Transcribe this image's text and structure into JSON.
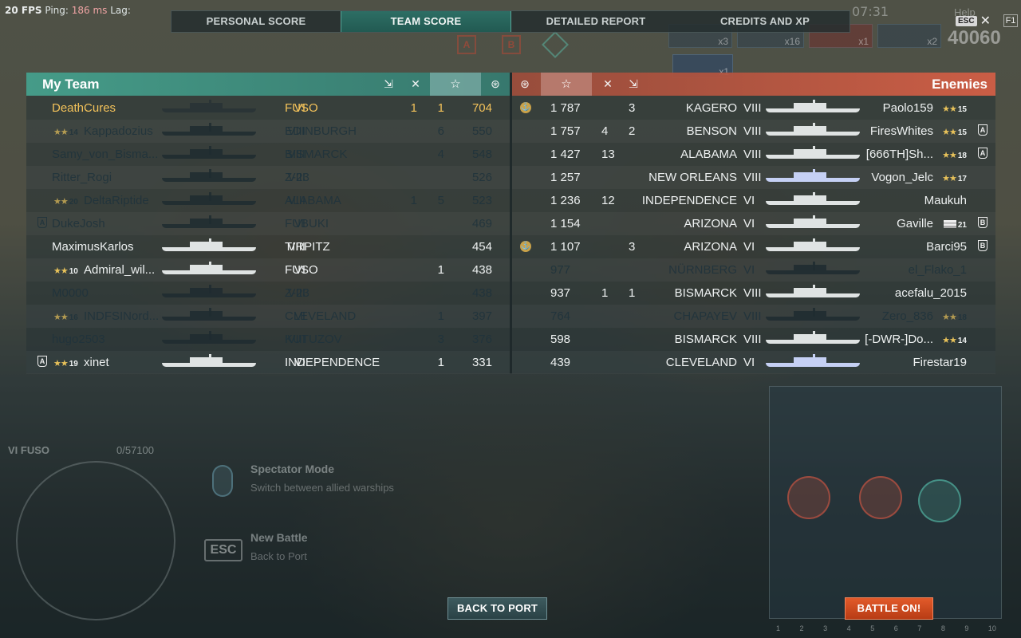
{
  "hud": {
    "fps": "20 FPS",
    "ping_label": "Ping:",
    "ping_value": "186 ms",
    "lag_label": "Lag:",
    "clock": "07:31",
    "help": "Help",
    "f1": "F1",
    "esc": "ESC",
    "team_score_total": "40060",
    "kill_feed": [
      "x3",
      "x16",
      "x1",
      "x2",
      "x1"
    ]
  },
  "tabs": [
    {
      "label": "PERSONAL SCORE",
      "active": false
    },
    {
      "label": "TEAM SCORE",
      "active": true
    },
    {
      "label": "DETAILED REPORT",
      "active": false
    },
    {
      "label": "CREDITS AND XP",
      "active": false
    }
  ],
  "caps": [
    "A",
    "B",
    "C"
  ],
  "my_team": {
    "title": "My Team",
    "players": [
      {
        "name": "DeathCures",
        "tier": "VI",
        "ship": "FUSO",
        "c1": "1",
        "c2": "1",
        "score": "704",
        "state": "me",
        "rank": ""
      },
      {
        "name": "Kappadozius",
        "tier": "VIII",
        "ship": "EDINBURGH",
        "c1": "",
        "c2": "6",
        "score": "550",
        "state": "dead",
        "rank": "14"
      },
      {
        "name": "Samy_von_Bisma...",
        "tier": "VIII",
        "ship": "BISMARCK",
        "c1": "",
        "c2": "4",
        "score": "548",
        "state": "dead",
        "rank": ""
      },
      {
        "name": "Ritter_Rogi",
        "tier": "VIII",
        "ship": "Z-23",
        "c1": "",
        "c2": "",
        "score": "526",
        "state": "dead",
        "rank": ""
      },
      {
        "name": "DeltaRiptide",
        "tier": "VIII",
        "ship": "ALABAMA",
        "c1": "1",
        "c2": "5",
        "score": "523",
        "state": "dead",
        "rank": "20"
      },
      {
        "name": "DukeJosh",
        "tier": "VI",
        "ship": "FUBUKI",
        "c1": "",
        "c2": "",
        "score": "469",
        "state": "dead",
        "rank": "",
        "division": "A"
      },
      {
        "name": "MaximusKarlos",
        "tier": "VIII",
        "ship": "TIRPITZ",
        "c1": "",
        "c2": "",
        "score": "454",
        "state": "alive",
        "rank": ""
      },
      {
        "name": "Admiral_wil...",
        "tier": "VI",
        "ship": "FUSO",
        "c1": "",
        "c2": "1",
        "score": "438",
        "state": "alive",
        "rank": "10"
      },
      {
        "name": "M0000",
        "tier": "VIII",
        "ship": "Z-23",
        "c1": "",
        "c2": "",
        "score": "438",
        "state": "dead",
        "rank": ""
      },
      {
        "name": "INDFSINord...",
        "tier": "VI",
        "ship": "CLEVELAND",
        "c1": "",
        "c2": "1",
        "score": "397",
        "state": "dead",
        "rank": "16"
      },
      {
        "name": "hugo2503",
        "tier": "VIII",
        "ship": "KUTUZOV",
        "c1": "",
        "c2": "3",
        "score": "376",
        "state": "dead",
        "rank": ""
      },
      {
        "name": "xinet",
        "tier": "VI",
        "ship": "INDEPENDENCE",
        "c1": "",
        "c2": "1",
        "score": "331",
        "state": "alive",
        "rank": "19",
        "division": "A"
      }
    ]
  },
  "enemies": {
    "title": "Enemies",
    "players": [
      {
        "name": "Paolo159",
        "tier": "VIII",
        "ship": "KAGERO",
        "c1": "",
        "c2": "3",
        "score": "1 787",
        "state": "alive",
        "rank": "15",
        "medal": true
      },
      {
        "name": "FiresWhites",
        "tier": "VIII",
        "ship": "BENSON",
        "c1": "4",
        "c2": "2",
        "score": "1 757",
        "state": "alive",
        "rank": "15",
        "division": "A"
      },
      {
        "name": "[666TH]Sh...",
        "tier": "VIII",
        "ship": "ALABAMA",
        "c1": "13",
        "c2": "",
        "score": "1 427",
        "state": "alive",
        "rank": "18",
        "division": "A"
      },
      {
        "name": "Vogon_Jelc",
        "tier": "VIII",
        "ship": "NEW ORLEANS",
        "c1": "",
        "c2": "",
        "score": "1 257",
        "state": "alive",
        "rank": "17",
        "blue": true
      },
      {
        "name": "Maukuh",
        "tier": "VI",
        "ship": "INDEPENDENCE",
        "c1": "12",
        "c2": "",
        "score": "1 236",
        "state": "alive",
        "rank": ""
      },
      {
        "name": "Gaville",
        "tier": "VI",
        "ship": "ARIZONA",
        "c1": "",
        "c2": "",
        "score": "1 154",
        "state": "alive",
        "rank": "21",
        "division": "B",
        "flag": true
      },
      {
        "name": "Barci95",
        "tier": "VI",
        "ship": "ARIZONA",
        "c1": "",
        "c2": "3",
        "score": "1 107",
        "state": "alive",
        "rank": "",
        "division": "B",
        "medal": true
      },
      {
        "name": "el_Flako_1",
        "tier": "VI",
        "ship": "NÜRNBERG",
        "c1": "",
        "c2": "",
        "score": "977",
        "state": "dead",
        "rank": ""
      },
      {
        "name": "acefalu_2015",
        "tier": "VIII",
        "ship": "BISMARCK",
        "c1": "1",
        "c2": "1",
        "score": "937",
        "state": "alive",
        "rank": ""
      },
      {
        "name": "Zero_836",
        "tier": "VIII",
        "ship": "CHAPAYEV",
        "c1": "",
        "c2": "",
        "score": "764",
        "state": "dead",
        "rank": "18"
      },
      {
        "name": "[-DWR-]Do...",
        "tier": "VIII",
        "ship": "BISMARCK",
        "c1": "",
        "c2": "",
        "score": "598",
        "state": "alive",
        "rank": "14"
      },
      {
        "name": "Firestar19",
        "tier": "VI",
        "ship": "CLEVELAND",
        "c1": "",
        "c2": "",
        "score": "439",
        "state": "alive",
        "rank": "",
        "blue": true
      }
    ]
  },
  "bottom": {
    "ship_label": "VI FUSO",
    "hp": "0/57100",
    "spectator_title": "Spectator Mode",
    "spectator_sub": "Switch between allied warships",
    "esc_key": "ESC",
    "new_battle_title": "New Battle",
    "new_battle_sub": "Back to Port",
    "minimap_cols": [
      "1",
      "2",
      "3",
      "4",
      "5",
      "6",
      "7",
      "8",
      "9",
      "10"
    ],
    "back_to_port": "BACK TO PORT",
    "battle_on": "BATTLE ON!"
  },
  "colors": {
    "team_green": "#46a08c",
    "enemy_red": "#d25f46",
    "highlight_gold": "#f3c25a",
    "battle_orange": "#e25a2a"
  }
}
